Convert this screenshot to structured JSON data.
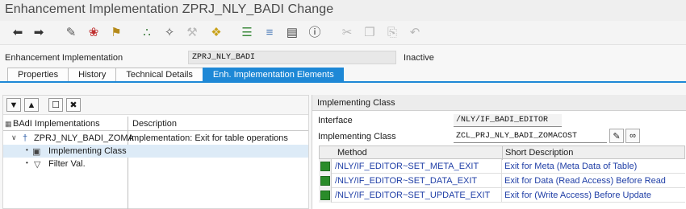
{
  "window": {
    "title": "Enhancement Implementation ZPRJ_NLY_BADI Change"
  },
  "toolbar": {
    "icons": [
      "back-arrow-icon",
      "forward-arrow-icon",
      "display-change-icon",
      "other-object-icon",
      "activate-icon",
      "where-used-icon",
      "wizard-icon",
      "test-icon",
      "tree-nodes-icon",
      "hierarchy-icon",
      "align-icon",
      "layout-icon",
      "info-icon",
      "cut-icon",
      "copy-icon",
      "paste-icon",
      "undo-icon"
    ]
  },
  "header": {
    "label": "Enhancement Implementation",
    "value": "ZPRJ_NLY_BADI",
    "status": "Inactive"
  },
  "tabs": [
    {
      "label": "Properties"
    },
    {
      "label": "History"
    },
    {
      "label": "Technical Details"
    },
    {
      "label": "Enh. Implementation Elements",
      "active": true
    }
  ],
  "left": {
    "columns": {
      "name": "BAdI Implementations",
      "description": "Description"
    },
    "tree": [
      {
        "name": "ZPRJ_NLY_BADI_ZOMA",
        "description": "Implementation: Exit for table operations"
      },
      {
        "name": "Implementing Class",
        "description": ""
      },
      {
        "name": "Filter Val.",
        "description": ""
      }
    ]
  },
  "right": {
    "section_title": "Implementing Class",
    "interface_label": "Interface",
    "interface_value": "/NLY/IF_BADI_EDITOR",
    "impl_class_label": "Implementing Class",
    "impl_class_value": "ZCL_PRJ_NLY_BADI_ZOMACOST",
    "grid": {
      "columns": {
        "method": "Method",
        "short_description": "Short Description"
      },
      "rows": [
        {
          "method": "/NLY/IF_EDITOR~SET_META_EXIT",
          "description": "Exit for Meta (Meta Data of Table)"
        },
        {
          "method": "/NLY/IF_EDITOR~SET_DATA_EXIT",
          "description": "Exit for Data (Read Access) Before Read"
        },
        {
          "method": "/NLY/IF_EDITOR~SET_UPDATE_EXIT",
          "description": "Exit for (Write Access) Before Update"
        }
      ]
    }
  },
  "colors": {
    "accent": "#1e88d6",
    "method_marker": "#2a8c2a",
    "link_text": "#1f3ea6"
  }
}
